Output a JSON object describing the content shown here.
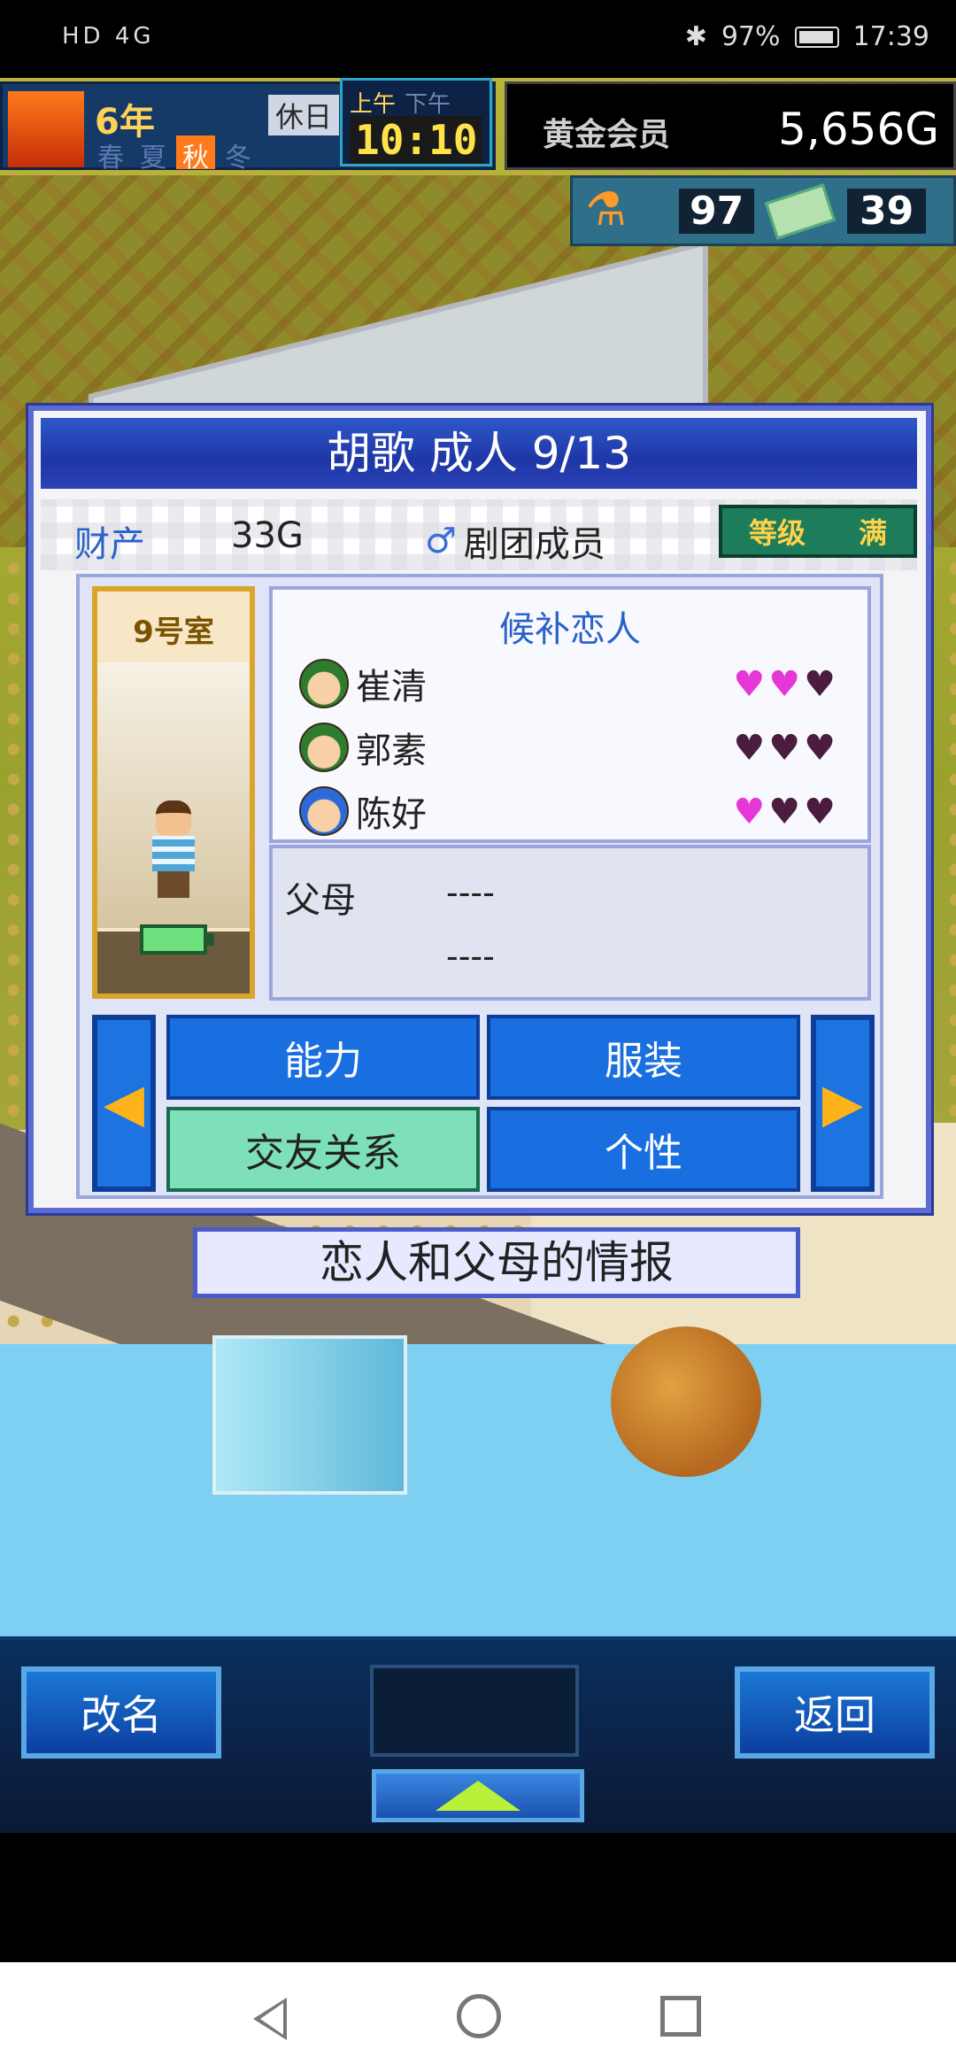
{
  "status_bar": {
    "left_icons": "HD 4G",
    "battery": "97%",
    "time": "17:39"
  },
  "hud": {
    "year": "6年",
    "holiday": "休日",
    "seasons": [
      "春",
      "夏",
      "秋",
      "冬"
    ],
    "active_season": "秋",
    "am": "上午",
    "pm": "下午",
    "clock": "10:10",
    "rank": "黄金会员",
    "gold": "5,656G",
    "points_1": "97",
    "points_2": "39"
  },
  "dialog": {
    "title": "胡歌 成人 9/13",
    "asset_label": "财产",
    "asset_value": "33G",
    "role": "剧团成员",
    "level_label": "等级",
    "level_value": "满",
    "room": "9号室",
    "lovers_title": "候补恋人",
    "lovers": [
      {
        "name": "崔清",
        "hearts": "♥♥♥",
        "level": 2
      },
      {
        "name": "郭素",
        "hearts": "♥♥♥",
        "level": 0
      },
      {
        "name": "陈好",
        "hearts": "♥♥♥",
        "level": 1
      }
    ],
    "parents_label": "父母",
    "parent_1": "----",
    "parent_2": "----",
    "tabs": [
      "能力",
      "服装",
      "交友关系",
      "个性"
    ],
    "active_tab": "交友关系"
  },
  "caption": "恋人和父母的情报",
  "bottom": {
    "rename": "改名",
    "back": "返回"
  },
  "colors": {
    "dialog_title_bg": "#1e36a6",
    "heart_on": "#e636d6",
    "heart_off": "#4a1d3f",
    "tab_bg": "#1a6fe0",
    "tab_active": "#7ee0b8"
  }
}
